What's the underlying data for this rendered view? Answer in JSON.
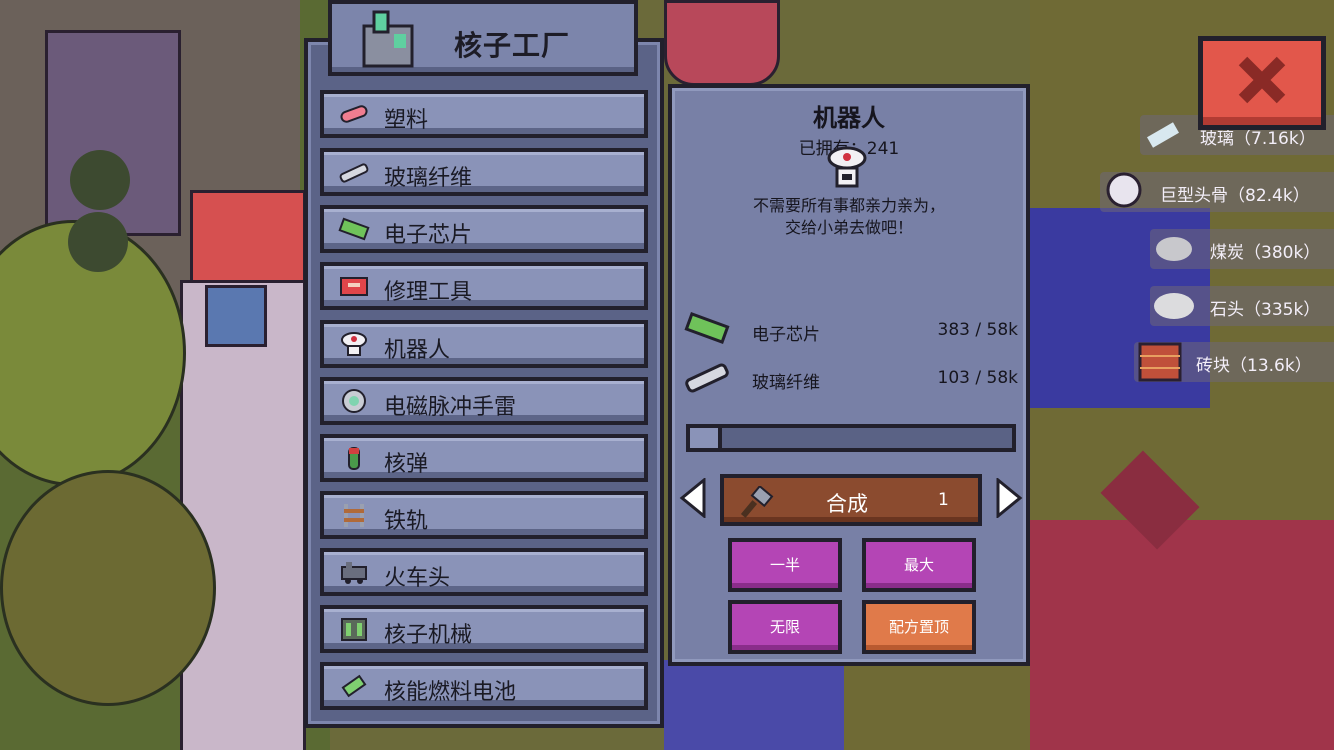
{
  "factory": {
    "title": "核子工厂",
    "items": [
      {
        "label": "塑料"
      },
      {
        "label": "玻璃纤维"
      },
      {
        "label": "电子芯片"
      },
      {
        "label": "修理工具"
      },
      {
        "label": "机器人"
      },
      {
        "label": "电磁脉冲手雷"
      },
      {
        "label": "核弹"
      },
      {
        "label": "铁轨"
      },
      {
        "label": "火车头"
      },
      {
        "label": "核子机械"
      },
      {
        "label": "核能燃料电池"
      }
    ]
  },
  "detail": {
    "title": "机器人",
    "owned": "已拥有：241",
    "description_line1": "不需要所有事都亲力亲为，",
    "description_line2": "交给小弟去做吧！",
    "ingredients": [
      {
        "name": "电子芯片",
        "count": "383 / 58k"
      },
      {
        "name": "玻璃纤维",
        "count": "103 / 58k"
      }
    ],
    "craft_label": "合成",
    "craft_quantity": "1",
    "slider_fraction": 0.0,
    "buttons": {
      "half": "一半",
      "max": "最大",
      "infinite": "无限",
      "pin_recipe": "配方置顶"
    }
  },
  "resources": [
    {
      "label": "玻璃（7.16k）"
    },
    {
      "label": "巨型头骨（82.4k）"
    },
    {
      "label": "煤炭（380k）"
    },
    {
      "label": "石头（335k）"
    },
    {
      "label": "砖块（13.6k）"
    }
  ],
  "colors": {
    "panel": "#7880a6",
    "button_purple": "#b445b5",
    "button_orange": "#e07a4a",
    "craft_brown": "#8b4b2f",
    "close_red": "#e2574b"
  }
}
